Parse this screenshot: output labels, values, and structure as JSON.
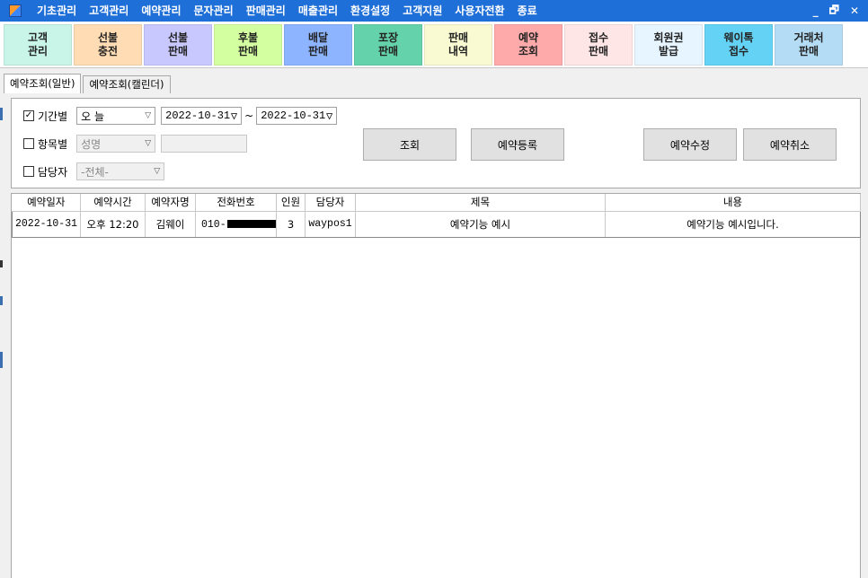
{
  "menubar": {
    "items": [
      "기초관리",
      "고객관리",
      "예약관리",
      "문자관리",
      "판매관리",
      "매출관리",
      "환경설정",
      "고객지원",
      "사용자전환",
      "종료"
    ],
    "window_controls": [
      "_",
      "🗗",
      "✕"
    ]
  },
  "big_buttons": [
    {
      "line1": "고객",
      "line2": "관리",
      "color": "#c8f5e8"
    },
    {
      "line1": "선불",
      "line2": "충전",
      "color": "#ffdcb4"
    },
    {
      "line1": "선불",
      "line2": "판매",
      "color": "#c8c8ff"
    },
    {
      "line1": "후불",
      "line2": "판매",
      "color": "#d4ffa0"
    },
    {
      "line1": "배달",
      "line2": "판매",
      "color": "#8cb4ff"
    },
    {
      "line1": "포장",
      "line2": "판매",
      "color": "#64d2aa"
    },
    {
      "line1": "판매",
      "line2": "내역",
      "color": "#fafad2"
    },
    {
      "line1": "예약",
      "line2": "조회",
      "color": "#ffaaaa"
    },
    {
      "line1": "접수",
      "line2": "판매",
      "color": "#ffe6e6"
    },
    {
      "line1": "회원권",
      "line2": "발급",
      "color": "#e6f5ff"
    },
    {
      "line1": "웨이톡",
      "line2": "접수",
      "color": "#64d2f5"
    },
    {
      "line1": "거래처",
      "line2": "판매",
      "color": "#b4dcf5"
    }
  ],
  "tabs": [
    {
      "label": "예약조회(일반)",
      "active": true
    },
    {
      "label": "예약조회(캘린더)",
      "active": false
    }
  ],
  "filters": {
    "period": {
      "label": "기간별",
      "checked": true,
      "preset": "오 늘",
      "date_from": "2022-10-31",
      "tilde": "~",
      "date_to": "2022-10-31"
    },
    "item": {
      "label": "항목별",
      "checked": false,
      "field": "성명",
      "value": ""
    },
    "staff": {
      "label": "담당자",
      "checked": false,
      "value": "-전체-"
    }
  },
  "actions": {
    "search": "조회",
    "register": "예약등록",
    "edit": "예약수정",
    "cancel": "예약취소"
  },
  "grid": {
    "columns": [
      "예약일자",
      "예약시간",
      "예약자명",
      "전화번호",
      "인원",
      "담당자",
      "제목",
      "내용"
    ],
    "rows": [
      {
        "date": "2022-10-31",
        "time": "오후 12:20",
        "name": "김웨이",
        "phone": "010-",
        "people": "3",
        "staff": "waypos1",
        "title": "예약기능 예시",
        "content": "예약기능 예시입니다."
      }
    ]
  }
}
